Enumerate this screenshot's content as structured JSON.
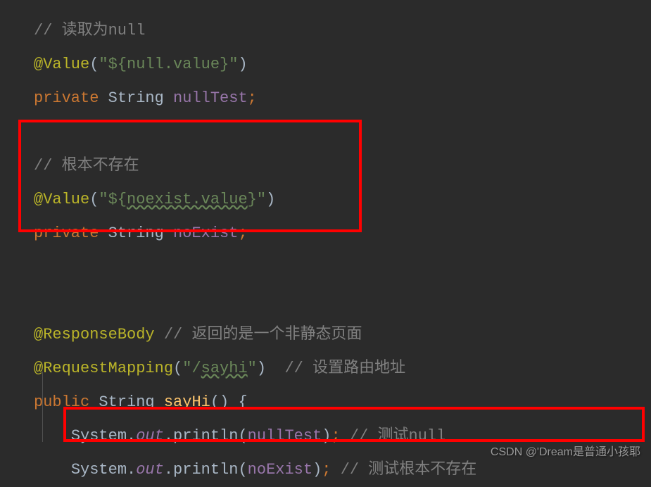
{
  "code": {
    "line1": {
      "comment": "// 读取为null"
    },
    "line2": {
      "annotation": "@Value",
      "paren_open": "(",
      "string": "\"${null.value}\"",
      "paren_close": ")"
    },
    "line3": {
      "keyword": "private",
      "type": " String ",
      "field": "nullTest",
      "semi": ";"
    },
    "line5": {
      "comment": "// 根本不存在"
    },
    "line6": {
      "annotation": "@Value",
      "paren_open": "(",
      "string_prefix": "\"${",
      "string_warn": "noexist.value",
      "string_suffix": "}\"",
      "paren_close": ")"
    },
    "line7": {
      "keyword": "private",
      "type": " String ",
      "field": "noExist",
      "semi": ";"
    },
    "line10": {
      "annotation": "@ResponseBody",
      "comment": " // 返回的是一个非静态页面"
    },
    "line11": {
      "annotation": "@RequestMapping",
      "paren_open": "(",
      "string_prefix": "\"/",
      "string_warn": "sayhi",
      "string_suffix": "\"",
      "paren_close": ")",
      "comment": "  // 设置路由地址"
    },
    "line12": {
      "keyword": "public",
      "type": " String ",
      "method": "sayHi",
      "parens": "() {"
    },
    "line13": {
      "cls": "System",
      "dot1": ".",
      "out": "out",
      "dot2": ".",
      "method": "println",
      "paren_open": "(",
      "arg": "nullTest",
      "paren_close": ")",
      "semi": ";",
      "comment": " // 测试null"
    },
    "line14": {
      "cls": "System",
      "dot1": ".",
      "out": "out",
      "dot2": ".",
      "method": "println",
      "paren_open": "(",
      "arg": "noExist",
      "paren_close": ")",
      "semi": ";",
      "comment": " // 测试根本不存在"
    }
  },
  "watermark": "CSDN @'Dream是普通小孩耶"
}
